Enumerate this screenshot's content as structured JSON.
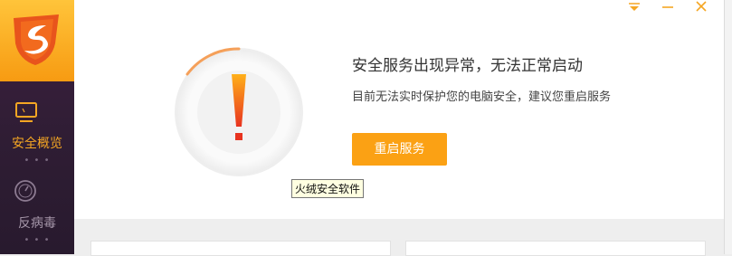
{
  "sidebar": {
    "items": [
      {
        "label": "安全概览",
        "icon": "monitor-icon",
        "active": true
      },
      {
        "label": "反病毒",
        "icon": "gauge-icon",
        "active": false
      }
    ],
    "dots": "• • •"
  },
  "main": {
    "title": "安全服务出现异常，无法正常启动",
    "subtitle": "目前无法实时保护您的电脑安全，建议您重启服务",
    "restart_button": "重启服务",
    "tooltip": "火绒安全软件"
  },
  "colors": {
    "accent": "#fba114",
    "sidebar_active_text": "#f5a623",
    "warning_red": "#e8412a"
  }
}
